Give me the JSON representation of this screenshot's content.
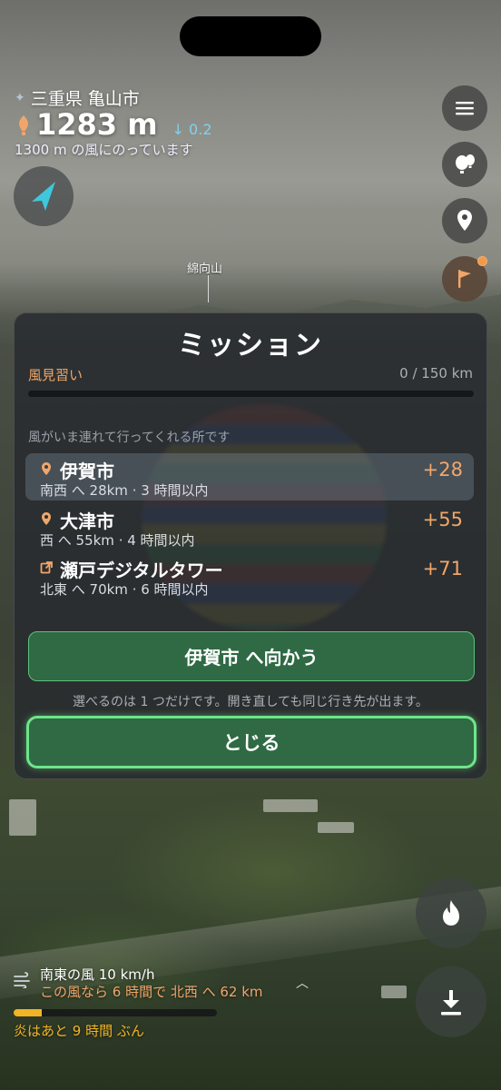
{
  "location": {
    "name": "三重県 亀山市",
    "icon": "star-icon"
  },
  "altitude": {
    "value": "1283 m",
    "vario": "0.2",
    "wind_note": "1300 m の風にのっています"
  },
  "map": {
    "peak_label": "綿向山"
  },
  "mission": {
    "title": "ミッション",
    "name": "風見習い",
    "progress_text": "0 / 150 km",
    "progress_fraction": 0.0,
    "hint": "風がいま連れて行ってくれる所です",
    "destinations": [
      {
        "name": "伊賀市",
        "detail": "南西 へ 28km · 3 時間以内",
        "points": "+28",
        "icon": "pin-icon",
        "selected": true
      },
      {
        "name": "大津市",
        "detail": "西 へ 55km · 4 時間以内",
        "points": "+55",
        "icon": "pin-icon",
        "selected": false
      },
      {
        "name": "瀬戸デジタルタワー",
        "detail": "北東 へ 70km · 6 時間以内",
        "points": "+71",
        "icon": "external-link-icon",
        "selected": false
      }
    ],
    "go_button": "伊賀市 へ向かう",
    "note": "選べるのは 1 つだけです。開き直しても同じ行き先が出ます。",
    "close_button": "とじる"
  },
  "wind": {
    "line1": "南東の風 10 km/h",
    "line2": "この風なら 6 時間で 北西 へ 62 km",
    "icon": "wind-icon"
  },
  "fuel": {
    "text": "炎はあと 9 時間 ぶん",
    "fraction": 0.14
  },
  "colors": {
    "accent": "#f0a66b",
    "fuel": "#f2b425",
    "button_green": "#2f6a44",
    "button_border": "#6ee58a"
  }
}
